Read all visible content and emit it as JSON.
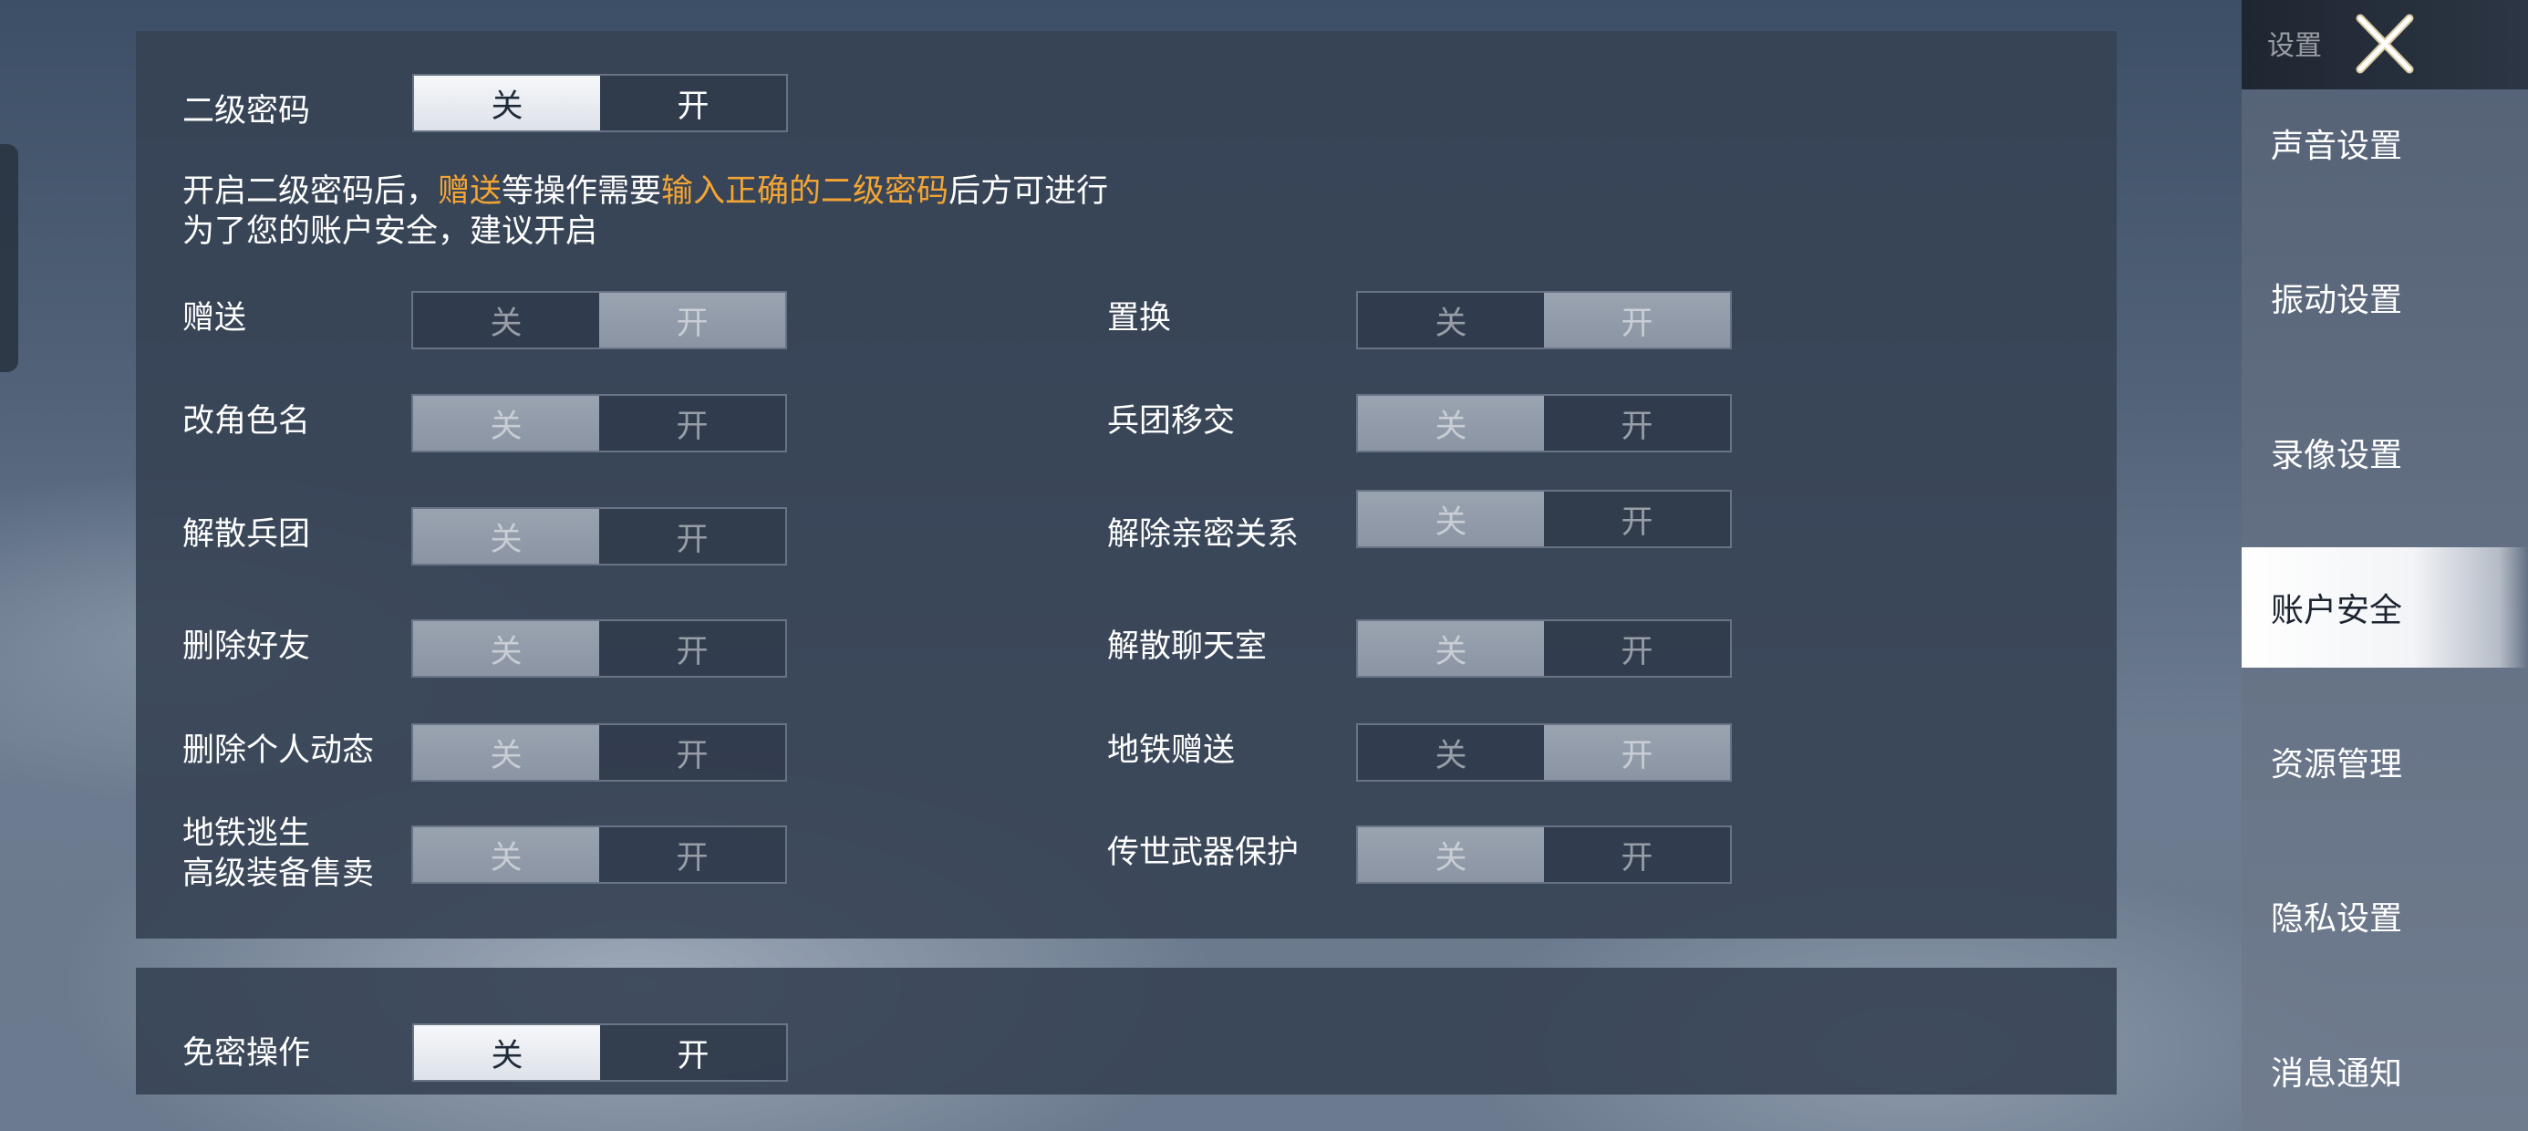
{
  "secondary_password": {
    "label": "二级密码",
    "off": "关",
    "on": "开",
    "selected": "off"
  },
  "info": {
    "line1_a": "开启二级密码后，",
    "line1_b": "赠送",
    "line1_c": "等操作需要",
    "line1_d": "输入正确的二级密码",
    "line1_e": "后方可进行",
    "line2": "为了您的账户安全，建议开启"
  },
  "settings_left": [
    {
      "label": "赠送",
      "selected": "on"
    },
    {
      "label": "改角色名",
      "selected": "off"
    },
    {
      "label": "解散兵团",
      "selected": "off"
    },
    {
      "label": "删除好友",
      "selected": "off"
    },
    {
      "label": "删除个人动态",
      "selected": "off"
    },
    {
      "label": "地铁逃生",
      "label2": "高级装备售卖",
      "selected": "off"
    }
  ],
  "settings_right": [
    {
      "label": "置换",
      "selected": "on"
    },
    {
      "label": "兵团移交",
      "selected": "off"
    },
    {
      "label": "解除亲密关系",
      "selected": "off"
    },
    {
      "label": "解散聊天室",
      "selected": "off"
    },
    {
      "label": "地铁赠送",
      "selected": "on"
    },
    {
      "label": "传世武器保护",
      "selected": "off"
    }
  ],
  "toggle_text": {
    "off": "关",
    "on": "开"
  },
  "password_free": {
    "label": "免密操作",
    "selected": "off"
  },
  "sidebar": {
    "title": "设置",
    "items": [
      {
        "label": "声音设置"
      },
      {
        "label": "振动设置"
      },
      {
        "label": "录像设置"
      },
      {
        "label": "账户安全",
        "active": true
      },
      {
        "label": "资源管理"
      },
      {
        "label": "隐私设置"
      },
      {
        "label": "消息通知"
      }
    ]
  },
  "colors": {
    "highlight": "#f3a534",
    "panel": "#364254",
    "active_tab": "#ffffff"
  },
  "icons": {
    "close": "close-x-icon"
  }
}
